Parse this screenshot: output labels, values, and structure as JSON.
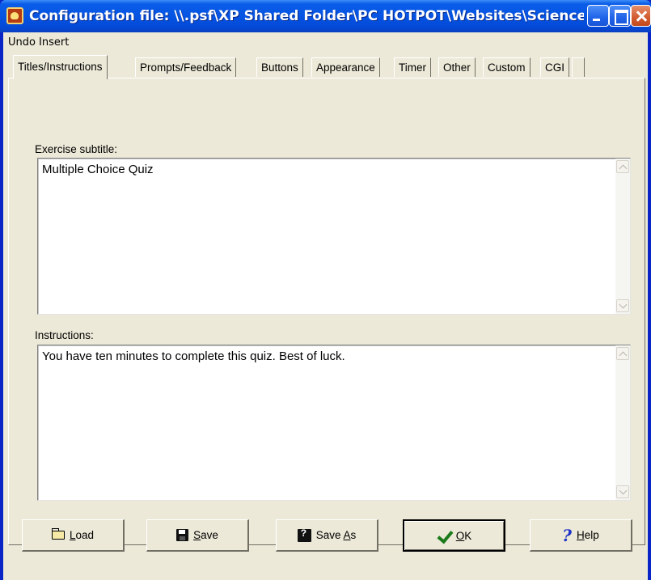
{
  "window": {
    "title": "Configuration file: \\\\.psf\\XP Shared Folder\\PC HOTPOT\\Websites\\ScienceQuiz.net\\..."
  },
  "menu": {
    "undo": "Undo",
    "insert": "Insert"
  },
  "tabs": [
    {
      "label": "Titles/Instructions",
      "active": true
    },
    {
      "label": "Prompts/Feedback",
      "active": false
    },
    {
      "label": "Buttons",
      "active": false
    },
    {
      "label": "Appearance",
      "active": false
    },
    {
      "label": "Timer",
      "active": false
    },
    {
      "label": "Other",
      "active": false
    },
    {
      "label": "Custom",
      "active": false
    },
    {
      "label": "CGI",
      "active": false
    }
  ],
  "fields": {
    "subtitle_label": "Exercise subtitle:",
    "subtitle_value": "Multiple Choice Quiz",
    "instructions_label": "Instructions:",
    "instructions_value": "You have ten minutes to complete this quiz. Best of luck."
  },
  "buttons": {
    "load": {
      "accel": "L",
      "rest": "oad",
      "icon": "folder-icon"
    },
    "save": {
      "accel": "S",
      "rest": "ave",
      "icon": "disk-icon"
    },
    "save_as": {
      "pre": "Save ",
      "accel": "A",
      "rest": "s",
      "icon": "disk-question-icon"
    },
    "ok": {
      "accel": "O",
      "rest": "K",
      "icon": "check-icon"
    },
    "help": {
      "accel": "H",
      "rest": "elp",
      "icon": "help-icon"
    }
  },
  "colors": {
    "titlebar": "#0554e3",
    "face": "#ece9d8",
    "close_button": "#d25b2f"
  }
}
